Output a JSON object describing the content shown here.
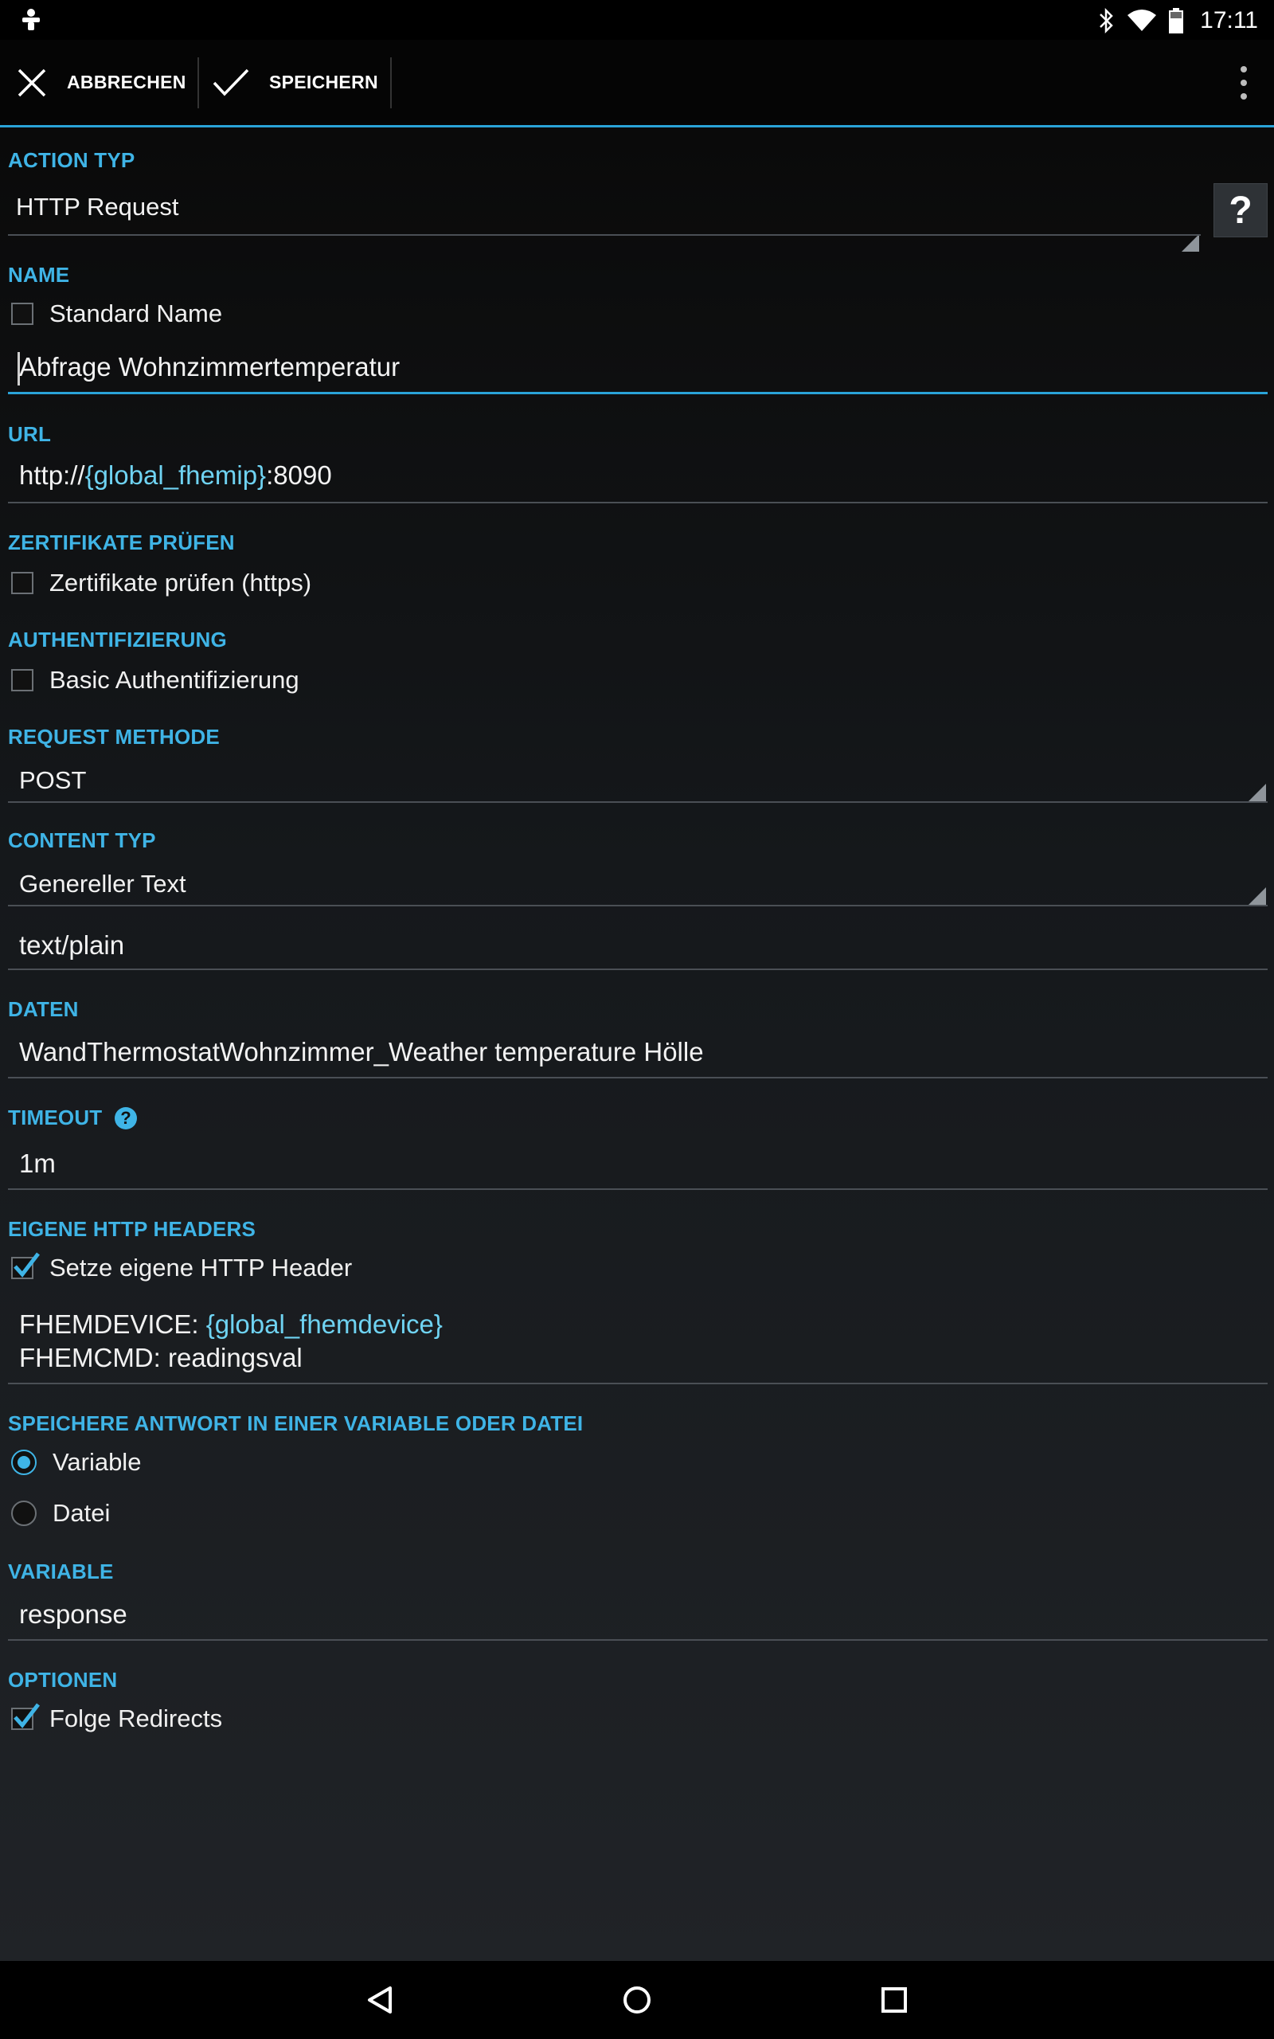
{
  "status_bar": {
    "time": "17:11"
  },
  "action_bar": {
    "cancel_label": "ABBRECHEN",
    "save_label": "SPEICHERN"
  },
  "form": {
    "action_type": {
      "label": "ACTION TYP",
      "value": "HTTP Request",
      "help": "?"
    },
    "name": {
      "label": "NAME",
      "default_name_checkbox": "Standard Name",
      "default_name_checked": false,
      "value": "Abfrage Wohnzimmertemperatur"
    },
    "url": {
      "label": "URL",
      "prefix": "http://",
      "variable": "{global_fhemip}",
      "suffix": ":8090"
    },
    "certificates": {
      "label": "ZERTIFIKATE PRÜFEN",
      "checkbox": "Zertifikate prüfen (https)",
      "checked": false
    },
    "auth": {
      "label": "AUTHENTIFIZIERUNG",
      "checkbox": "Basic Authentifizierung",
      "checked": false
    },
    "request_method": {
      "label": "REQUEST METHODE",
      "value": "POST"
    },
    "content_type": {
      "label": "CONTENT TYP",
      "value": "Genereller Text",
      "mime": "text/plain"
    },
    "data": {
      "label": "DATEN",
      "value": "WandThermostatWohnzimmer_Weather temperature Hölle"
    },
    "timeout": {
      "label": "TIMEOUT",
      "help": "?",
      "value": "1m"
    },
    "headers": {
      "label": "EIGENE HTTP HEADERS",
      "checkbox": "Setze eigene HTTP Header",
      "checked": true,
      "line1_key": "FHEMDEVICE: ",
      "line1_var": "{global_fhemdevice}",
      "line2": "FHEMCMD: readingsval"
    },
    "store_response": {
      "label": "SPEICHERE ANTWORT IN EINER VARIABLE ODER DATEI",
      "option_variable": "Variable",
      "option_file": "Datei",
      "selected": "Variable"
    },
    "variable": {
      "label": "VARIABLE",
      "value": "response"
    },
    "options": {
      "label": "OPTIONEN",
      "checkbox": "Folge Redirects",
      "checked": true
    }
  },
  "colors": {
    "accent": "#3fb4e6",
    "variable_text": "#6fd3f2",
    "background": "#000000"
  }
}
